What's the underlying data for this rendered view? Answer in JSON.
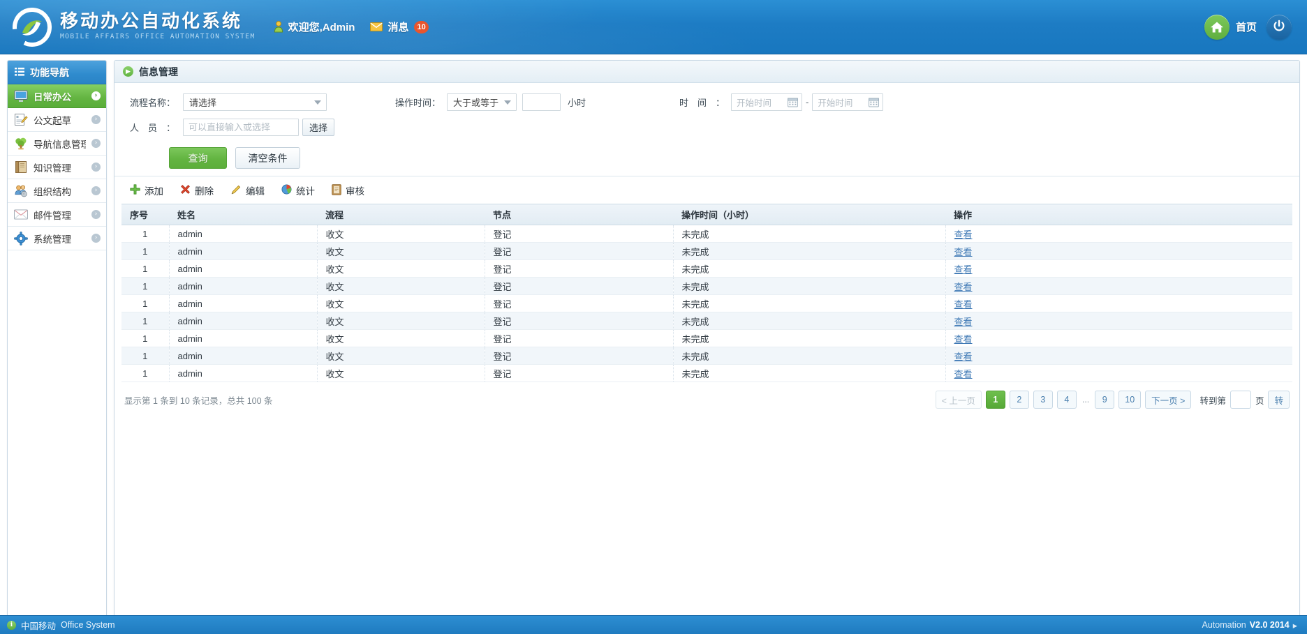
{
  "header": {
    "brand_cn": "移动办公自动化系统",
    "brand_en": "MOBILE AFFAIRS OFFICE AUTOMATION SYSTEM",
    "welcome": "欢迎您,Admin",
    "messages_label": "消息",
    "messages_count": "10",
    "home_label": "首页",
    "icons": {
      "user": "user-icon",
      "mail": "mail-icon",
      "home": "home-icon",
      "power": "power-icon"
    },
    "colors": {
      "bar_blue": "#1d7cc4",
      "accent_green": "#63b441",
      "badge_red": "#e8552d"
    }
  },
  "sidebar": {
    "title": "功能导航",
    "items": [
      {
        "label": "日常办公",
        "icon": "monitor-icon",
        "active": true
      },
      {
        "label": "公文起草",
        "icon": "document-edit-icon",
        "active": false
      },
      {
        "label": "导航信息管理",
        "icon": "tree-icon",
        "active": false
      },
      {
        "label": "知识管理",
        "icon": "book-icon",
        "active": false
      },
      {
        "label": "组织结构",
        "icon": "users-gear-icon",
        "active": false
      },
      {
        "label": "邮件管理",
        "icon": "envelope-icon",
        "active": false
      },
      {
        "label": "系统管理",
        "icon": "gear-icon",
        "active": false
      }
    ]
  },
  "page": {
    "title": "信息管理"
  },
  "filters": {
    "flow_label": "流程名称：",
    "flow_value": "请选择",
    "person_label": "人员：",
    "person_placeholder": "可以直接输入或选择",
    "person_value": "",
    "select_button": "选择",
    "optime_label": "操作时间：",
    "optime_operator": "大于或等于",
    "optime_value": "",
    "optime_unit": "小时",
    "time_label": "时间：",
    "time_start_placeholder": "开始时间",
    "time_start_value": "",
    "time_end_placeholder": "开始时间",
    "time_end_value": "",
    "time_separator": "-",
    "search_button": "查询",
    "reset_button": "清空条件"
  },
  "toolbar": [
    {
      "label": "添加",
      "icon": "plus-icon"
    },
    {
      "label": "删除",
      "icon": "cross-icon"
    },
    {
      "label": "编辑",
      "icon": "pencil-icon"
    },
    {
      "label": "统计",
      "icon": "pie-chart-icon"
    },
    {
      "label": "审核",
      "icon": "audit-book-icon"
    }
  ],
  "table": {
    "columns": [
      "序号",
      "姓名",
      "流程",
      "节点",
      "操作时间（小时）",
      "操作"
    ],
    "rows": [
      [
        "1",
        "admin",
        "收文",
        "登记",
        "未完成",
        "查看"
      ],
      [
        "1",
        "admin",
        "收文",
        "登记",
        "未完成",
        "查看"
      ],
      [
        "1",
        "admin",
        "收文",
        "登记",
        "未完成",
        "查看"
      ],
      [
        "1",
        "admin",
        "收文",
        "登记",
        "未完成",
        "查看"
      ],
      [
        "1",
        "admin",
        "收文",
        "登记",
        "未完成",
        "查看"
      ],
      [
        "1",
        "admin",
        "收文",
        "登记",
        "未完成",
        "查看"
      ],
      [
        "1",
        "admin",
        "收文",
        "登记",
        "未完成",
        "查看"
      ],
      [
        "1",
        "admin",
        "收文",
        "登记",
        "未完成",
        "查看"
      ],
      [
        "1",
        "admin",
        "收文",
        "登记",
        "未完成",
        "查看"
      ]
    ]
  },
  "pagination": {
    "info": "显示第 1 条到 10 条记录，总共 100 条",
    "prev": "< 上一页",
    "next": "下一页 >",
    "pages": [
      "1",
      "2",
      "3",
      "4"
    ],
    "ellipsis": "...",
    "tail_pages": [
      "9",
      "10"
    ],
    "active_page": "1",
    "goto_prefix": "转到第",
    "goto_value": "",
    "goto_suffix": "页",
    "goto_button": "转"
  },
  "footer": {
    "left_cn": "中国移动",
    "left_en": "Office System",
    "right_prefix": "Automation",
    "right_version": "V2.0 2014",
    "right_arrow": "▸"
  }
}
